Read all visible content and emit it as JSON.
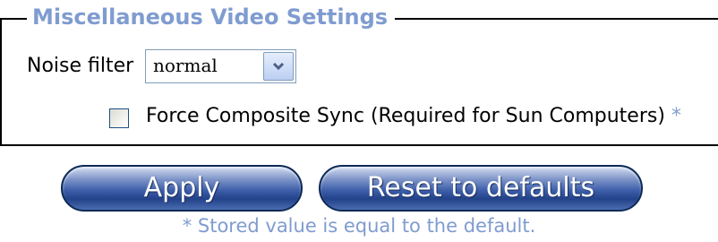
{
  "section": {
    "legend": "Miscellaneous Video Settings"
  },
  "noise_filter": {
    "label": "Noise filter",
    "selected": "normal"
  },
  "force_sync": {
    "label": "Force Composite Sync (Required for Sun Computers)",
    "marker": "*",
    "checked": false
  },
  "buttons": {
    "apply": "Apply",
    "reset": "Reset to defaults"
  },
  "footnote": "* Stored value is equal to the default.",
  "colors": {
    "accent": "#7f9cd0",
    "button_dark": "#23428a",
    "button_light": "#d4def1"
  },
  "icons": {
    "dropdown": "chevron-down-icon"
  }
}
